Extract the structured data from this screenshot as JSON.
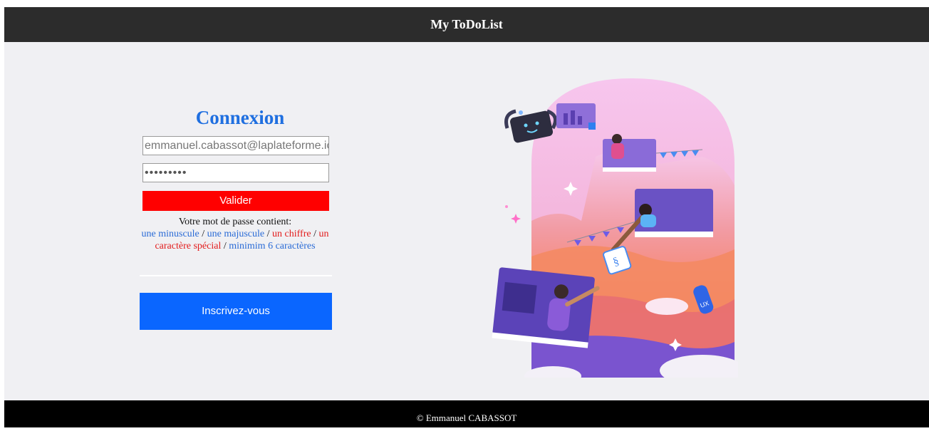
{
  "header": {
    "title": "My ToDoList"
  },
  "login": {
    "title": "Connexion",
    "email_value": "emmanuel.cabassot@laplateforme.io",
    "password_value": "•••••••••",
    "submit_label": "Valider",
    "password_intro": "Votre mot de passe contient:",
    "rules": {
      "lowercase": "une minuscule",
      "uppercase": "une majuscule",
      "digit": "un chiffre",
      "special": "un caractère spécial",
      "min_length": "minimim 6 caractères"
    },
    "separator": " / ",
    "signup_label": "Inscrivez-vous"
  },
  "footer": {
    "text": "© Emmanuel CABASSOT"
  },
  "colors": {
    "header_bg": "#2c2c2c",
    "page_bg": "#f0f0f3",
    "accent_blue": "#1f6fe0",
    "submit_red": "#ff0000",
    "signup_blue": "#0a66ff"
  }
}
